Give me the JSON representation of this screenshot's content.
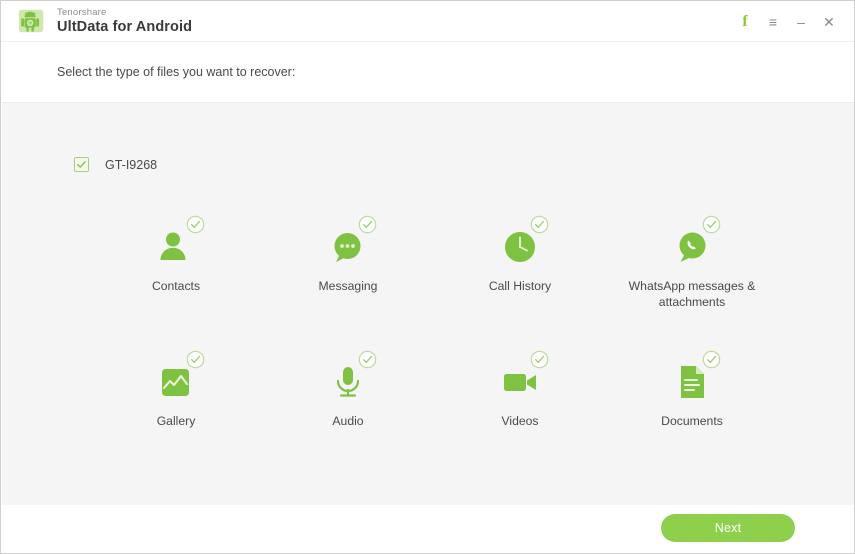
{
  "window": {
    "company": "Tenorshare",
    "product": "UltData for Android",
    "logo_icon": "android-robot-icon"
  },
  "titlebar_controls": [
    {
      "name": "facebook-button",
      "glyph": "f",
      "label": "Facebook"
    },
    {
      "name": "menu-button",
      "glyph": "≡",
      "label": "Menu"
    },
    {
      "name": "minimize-button",
      "glyph": "–",
      "label": "Minimize"
    },
    {
      "name": "close-button",
      "glyph": "✕",
      "label": "Close"
    }
  ],
  "instruction": "Select the type of files you want to recover:",
  "device": {
    "name": "GT-I9268",
    "checked": true
  },
  "file_types": [
    {
      "label": "Contacts",
      "icon": "contact-person-icon",
      "checked": true
    },
    {
      "label": "Messaging",
      "icon": "speech-bubble-icon",
      "checked": true
    },
    {
      "label": "Call History",
      "icon": "clock-icon",
      "checked": true
    },
    {
      "label": "WhatsApp messages & attachments",
      "icon": "whatsapp-icon",
      "checked": true
    },
    {
      "label": "Gallery",
      "icon": "photo-icon",
      "checked": true
    },
    {
      "label": "Audio",
      "icon": "microphone-icon",
      "checked": true
    },
    {
      "label": "Videos",
      "icon": "video-camera-icon",
      "checked": true
    },
    {
      "label": "Documents",
      "icon": "document-icon",
      "checked": true
    }
  ],
  "footer": {
    "next_label": "Next"
  },
  "colors": {
    "accent_green": "#8ed04b",
    "icon_green": "#7fc242",
    "badge_green": "#a6cf7f",
    "panel_bg": "#f5f5f5",
    "text": "#4a4a4a"
  }
}
